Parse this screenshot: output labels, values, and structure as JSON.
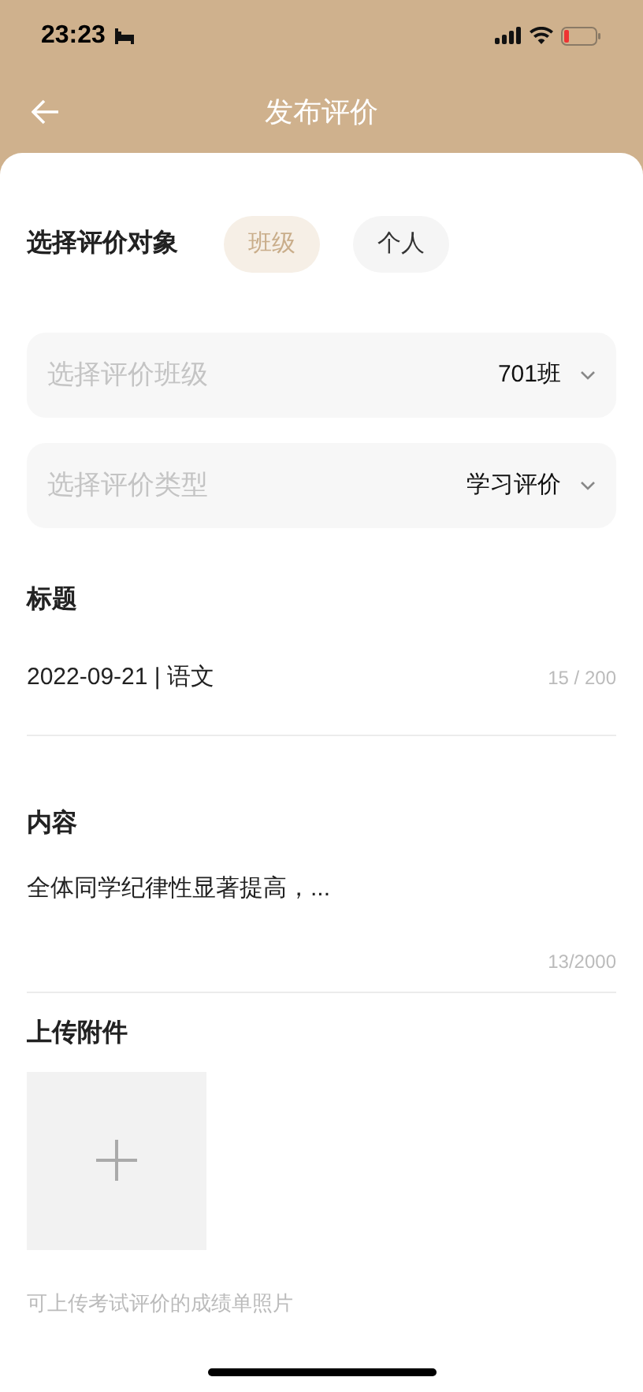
{
  "status_bar": {
    "time": "23:23"
  },
  "nav": {
    "title": "发布评价"
  },
  "target": {
    "label": "选择评价对象",
    "options": [
      {
        "label": "班级",
        "selected": true
      },
      {
        "label": "个人",
        "selected": false
      }
    ]
  },
  "selects": [
    {
      "label": "选择评价班级",
      "value": "701班"
    },
    {
      "label": "选择评价类型",
      "value": "学习评价"
    }
  ],
  "title_field": {
    "label": "标题",
    "value": "2022-09-21 | 语文",
    "count": "15 / 200"
  },
  "content_field": {
    "label": "内容",
    "value": "全体同学纪律性显著提高，...",
    "count": "13/2000"
  },
  "upload": {
    "label": "上传附件",
    "hint": "可上传考试评价的成绩单照片"
  }
}
